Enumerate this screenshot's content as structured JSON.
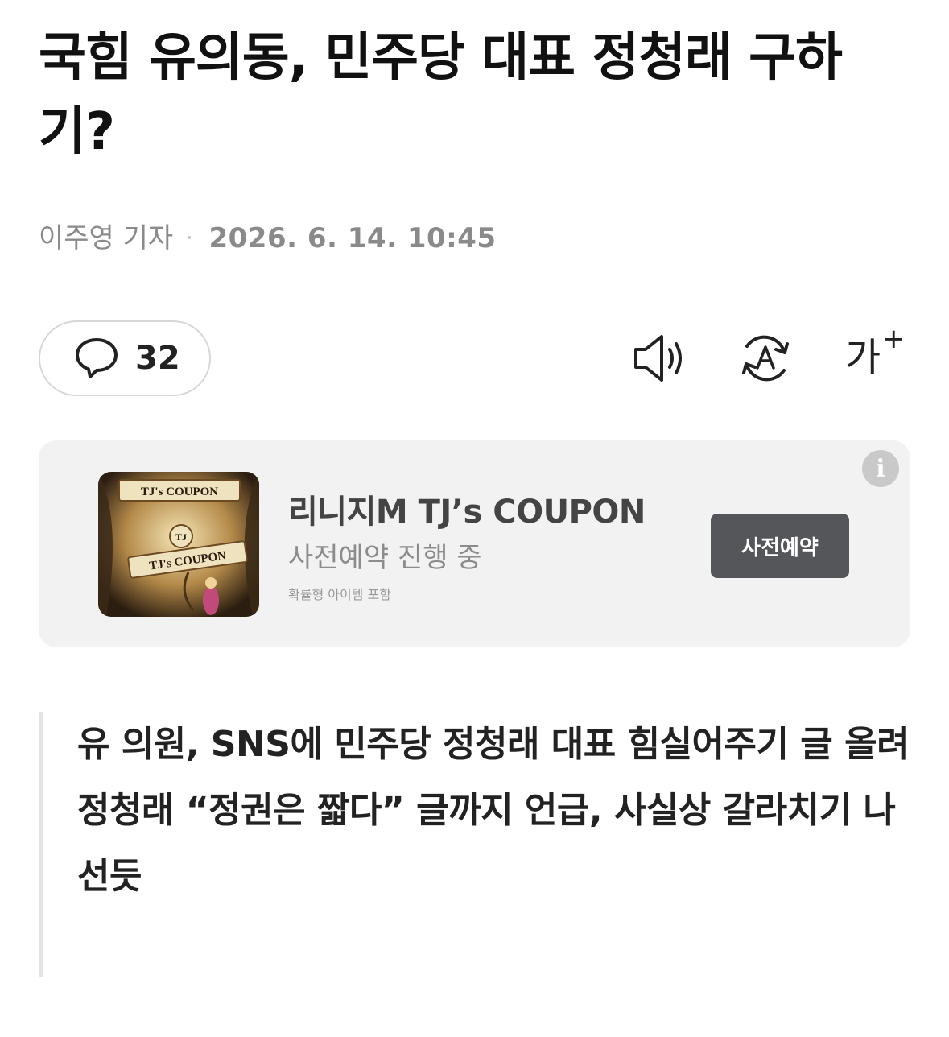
{
  "article": {
    "headline": "국힘 유의동, 민주당 대표 정청래 구하기?",
    "author": "이주영 기자",
    "separator": "·",
    "datetime": "2026. 6. 14. 10:45"
  },
  "toolbar": {
    "comment_count": "32",
    "comment_icon": "speech-bubble-icon",
    "speaker_icon": "speaker-icon",
    "translate_icon": "translate-icon",
    "font_size_label": "가",
    "font_size_plus": "+"
  },
  "ad": {
    "thumbnail_label_top": "TJ's COUPON",
    "thumbnail_label_bottom": "TJ's COUPON",
    "thumbnail_emblem": "TJ",
    "title": "리니지M TJ’s COUPON",
    "subtitle": "사전예약 진행 중",
    "note": "확률형 아이템 포함",
    "cta_label": "사전예약",
    "info_glyph": "i"
  },
  "summary": {
    "lines": [
      "유 의원, SNS에 민주당 정청래 대표 힘실어주기 글 올려",
      "정청래 “정권은 짧다” 글까지 언급, 사실상 갈라치기 나선듯"
    ]
  },
  "colors": {
    "text_primary": "#111111",
    "text_muted": "#8a8a8a",
    "ad_background": "#f2f2f2",
    "cta_background": "#55565a",
    "quote_bar": "#e3e3e3"
  }
}
